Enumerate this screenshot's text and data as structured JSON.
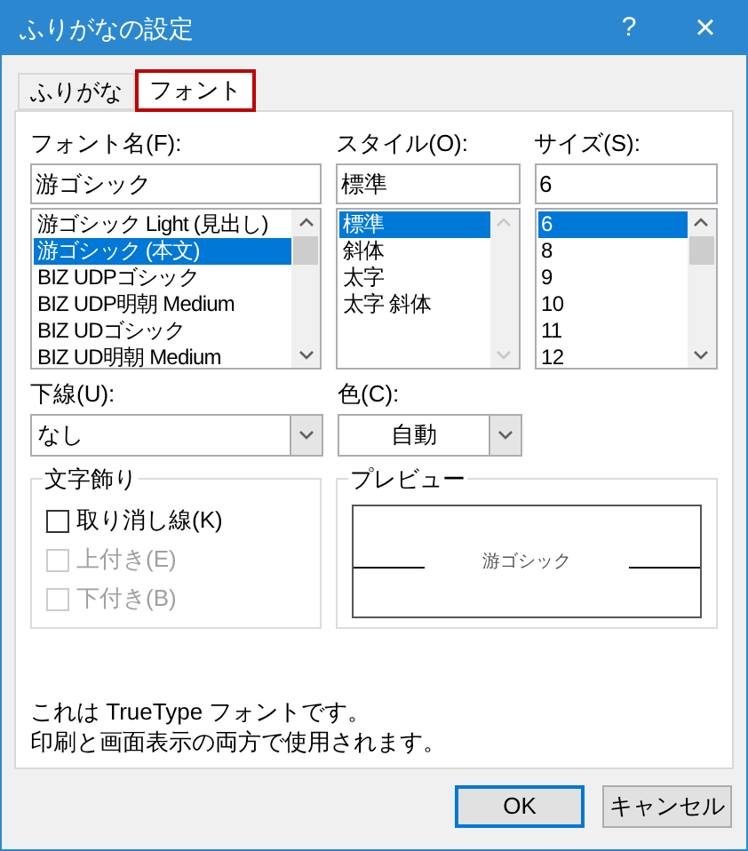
{
  "window": {
    "title": "ふりがなの設定",
    "help_button": "?",
    "close_button": "×"
  },
  "tabs": [
    {
      "label": "ふりがな",
      "selected": false
    },
    {
      "label": "フォント",
      "selected": true
    }
  ],
  "font_name": {
    "label": "フォント名(F):",
    "value": "游ゴシック",
    "items": [
      {
        "label": "游ゴシック Light (見出し)",
        "selected": false
      },
      {
        "label": "游ゴシック (本文)",
        "selected": true
      },
      {
        "label": "BIZ UDPゴシック",
        "selected": false
      },
      {
        "label": "BIZ UDP明朝 Medium",
        "selected": false
      },
      {
        "label": "BIZ UDゴシック",
        "selected": false
      },
      {
        "label": "BIZ UD明朝 Medium",
        "selected": false
      }
    ]
  },
  "style": {
    "label": "スタイル(O):",
    "value": "標準",
    "items": [
      {
        "label": "標準",
        "selected": true
      },
      {
        "label": "斜体",
        "selected": false
      },
      {
        "label": "太字",
        "selected": false
      },
      {
        "label": "太字 斜体",
        "selected": false
      }
    ]
  },
  "size": {
    "label": "サイズ(S):",
    "value": "6",
    "items": [
      {
        "label": "6",
        "selected": true
      },
      {
        "label": "8",
        "selected": false
      },
      {
        "label": "9",
        "selected": false
      },
      {
        "label": "10",
        "selected": false
      },
      {
        "label": "11",
        "selected": false
      },
      {
        "label": "12",
        "selected": false
      }
    ]
  },
  "underline": {
    "label": "下線(U):",
    "value": "なし"
  },
  "color": {
    "label": "色(C):",
    "value": "自動"
  },
  "effects": {
    "title": "文字飾り",
    "options": [
      {
        "label": "取り消し線(K)",
        "checked": false,
        "disabled": false
      },
      {
        "label": "上付き(E)",
        "checked": false,
        "disabled": true
      },
      {
        "label": "下付き(B)",
        "checked": false,
        "disabled": true
      }
    ]
  },
  "preview": {
    "title": "プレビュー",
    "sample": "游ゴシック"
  },
  "info": [
    "これは TrueType フォントです。",
    "印刷と画面表示の両方で使用されます。"
  ],
  "buttons": [
    {
      "label": "OK",
      "default": true
    },
    {
      "label": "キャンセル",
      "default": false
    }
  ]
}
